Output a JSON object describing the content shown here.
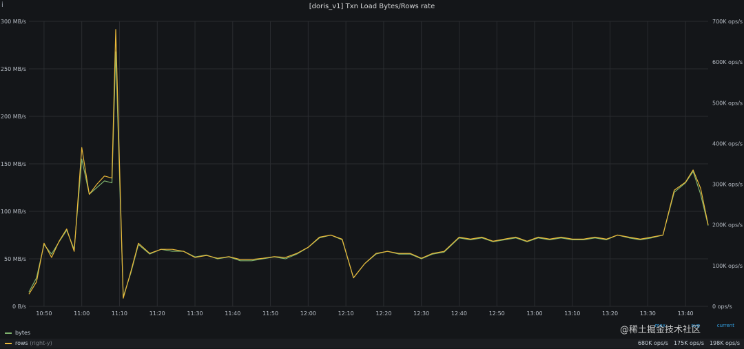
{
  "panel": {
    "title": "[doris_v1] Txn Load Bytes/Rows rate",
    "info_glyph": "i"
  },
  "colors": {
    "bytes": "#7eb26d",
    "rows": "#eab839",
    "grid": "#2a2c30",
    "text": "#b8bec6"
  },
  "chart_data": {
    "type": "line",
    "title": "[doris_v1] Txn Load Bytes/Rows rate",
    "x_ticks": [
      "10:50",
      "11:00",
      "11:10",
      "11:20",
      "11:30",
      "11:40",
      "11:50",
      "12:00",
      "12:10",
      "12:20",
      "12:30",
      "12:40",
      "12:50",
      "13:00",
      "13:10",
      "13:20",
      "13:30",
      "13:40"
    ],
    "x_range": [
      "10:46",
      "13:46"
    ],
    "y_left": {
      "ticks": [
        "0 B/s",
        "50 MB/s",
        "100 MB/s",
        "150 MB/s",
        "200 MB/s",
        "250 MB/s",
        "300 MB/s"
      ],
      "range": [
        0,
        300
      ],
      "unit": "MB/s"
    },
    "y_right": {
      "ticks": [
        "0 ops/s",
        "100K ops/s",
        "200K ops/s",
        "300K ops/s",
        "400K ops/s",
        "500K ops/s",
        "600K ops/s",
        "700K ops/s"
      ],
      "range": [
        0,
        700
      ],
      "unit": "K ops/s"
    },
    "grid": true,
    "legend_position": "bottom",
    "series": [
      {
        "name": "bytes",
        "axis": "left",
        "x": [
          "10:46",
          "10:48",
          "10:50",
          "10:52",
          "10:54",
          "10:56",
          "10:58",
          "11:00",
          "11:02",
          "11:04",
          "11:06",
          "11:08",
          "11:09",
          "11:11",
          "11:13",
          "11:15",
          "11:18",
          "11:21",
          "11:24",
          "11:27",
          "11:30",
          "11:33",
          "11:36",
          "11:39",
          "11:42",
          "11:45",
          "11:48",
          "11:51",
          "11:54",
          "11:57",
          "12:00",
          "12:03",
          "12:06",
          "12:09",
          "12:12",
          "12:15",
          "12:18",
          "12:21",
          "12:24",
          "12:27",
          "12:30",
          "12:33",
          "12:36",
          "12:40",
          "12:43",
          "12:46",
          "12:49",
          "12:52",
          "12:55",
          "12:58",
          "13:01",
          "13:04",
          "13:07",
          "13:10",
          "13:13",
          "13:16",
          "13:19",
          "13:22",
          "13:25",
          "13:28",
          "13:31",
          "13:34",
          "13:37",
          "13:40",
          "13:42",
          "13:44",
          "13:46"
        ],
        "values": [
          15,
          30,
          65,
          55,
          68,
          80,
          60,
          155,
          118,
          125,
          132,
          130,
          268,
          10,
          35,
          65,
          55,
          60,
          58,
          58,
          52,
          54,
          50,
          52,
          48,
          48,
          50,
          52,
          50,
          55,
          62,
          72,
          75,
          70,
          30,
          45,
          55,
          58,
          55,
          55,
          50,
          55,
          57,
          72,
          70,
          72,
          68,
          70,
          72,
          68,
          72,
          70,
          72,
          70,
          70,
          72,
          70,
          75,
          72,
          70,
          72,
          75,
          120,
          130,
          142,
          118,
          85
        ]
      },
      {
        "name": "rows",
        "axis": "right",
        "x": [
          "10:46",
          "10:48",
          "10:50",
          "10:52",
          "10:54",
          "10:56",
          "10:58",
          "11:00",
          "11:02",
          "11:04",
          "11:06",
          "11:08",
          "11:09",
          "11:11",
          "11:13",
          "11:15",
          "11:18",
          "11:21",
          "11:24",
          "11:27",
          "11:30",
          "11:33",
          "11:36",
          "11:39",
          "11:42",
          "11:45",
          "11:48",
          "11:51",
          "11:54",
          "11:57",
          "12:00",
          "12:03",
          "12:06",
          "12:09",
          "12:12",
          "12:15",
          "12:18",
          "12:21",
          "12:24",
          "12:27",
          "12:30",
          "12:33",
          "12:36",
          "12:40",
          "12:43",
          "12:46",
          "12:49",
          "12:52",
          "12:55",
          "12:58",
          "13:01",
          "13:04",
          "13:07",
          "13:10",
          "13:13",
          "13:16",
          "13:19",
          "13:22",
          "13:25",
          "13:28",
          "13:31",
          "13:34",
          "13:37",
          "13:40",
          "13:42",
          "13:44",
          "13:46"
        ],
        "values": [
          30,
          60,
          155,
          120,
          160,
          190,
          135,
          390,
          275,
          300,
          320,
          315,
          680,
          20,
          85,
          155,
          130,
          140,
          140,
          135,
          120,
          125,
          118,
          122,
          115,
          115,
          118,
          122,
          120,
          130,
          145,
          170,
          175,
          165,
          70,
          105,
          130,
          135,
          130,
          130,
          118,
          130,
          135,
          170,
          165,
          170,
          160,
          165,
          170,
          160,
          170,
          165,
          170,
          165,
          165,
          170,
          165,
          175,
          170,
          165,
          170,
          175,
          285,
          305,
          335,
          290,
          200
        ]
      }
    ]
  },
  "legend": {
    "headers": {
      "max": "max",
      "avg": "avg",
      "current": "current"
    },
    "items": [
      {
        "name": "bytes",
        "hint": ""
      },
      {
        "name": "rows",
        "hint": "(right-y)",
        "max": "680K ops/s",
        "avg": "175K ops/s",
        "current": "198K ops/s"
      }
    ]
  },
  "watermark": "@稀土掘金技术社区"
}
